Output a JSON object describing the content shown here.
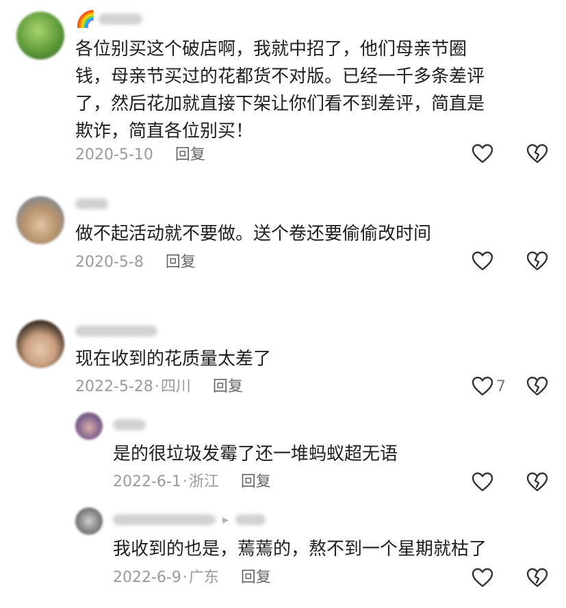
{
  "comments": [
    {
      "text_lines": [
        "各位别买这个破店啊，我就中招了，他们母亲节圈",
        "钱，母亲节买过的花都货不对版。已经一千多条差评",
        "了，然后花加就直接下架让你们看不到差评，简直是",
        "欺诈，简直各位别买！"
      ],
      "date": "2020-5-10",
      "location": "",
      "reply_label": "回复",
      "like_count": "",
      "user_badge": "🌈",
      "avatar_colors": [
        "#3f7f2f",
        "#9ccf5a"
      ]
    },
    {
      "text_lines": [
        "做不起活动就不要做。送个卷还要偷偷改时间"
      ],
      "date": "2020-5-8",
      "location": "",
      "reply_label": "回复",
      "like_count": "",
      "avatar_colors": [
        "#6a86a6",
        "#d9b89a"
      ]
    },
    {
      "text_lines": [
        "现在收到的花质量太差了"
      ],
      "date": "2022-5-28",
      "location": "四川",
      "reply_label": "回复",
      "like_count": "7",
      "avatar_colors": [
        "#3a2a20",
        "#e0c2a6"
      ],
      "replies": [
        {
          "text_lines": [
            "是的很垃圾发霉了还一堆蚂蚁超无语"
          ],
          "date": "2022-6-1",
          "location": "浙江",
          "reply_label": "回复",
          "like_count": "",
          "avatar_colors": [
            "#5a4a80",
            "#c9a3a0"
          ]
        },
        {
          "text_lines": [
            "我收到的也是，蔫蔫的，熬不到一个星期就枯了"
          ],
          "date": "2022-6-9",
          "location": "广东",
          "reply_label": "回复",
          "like_count": "",
          "avatar_colors": [
            "#555555",
            "#bbbbbb"
          ]
        }
      ]
    }
  ],
  "icons": {
    "like": "heart-outline-icon",
    "dislike": "broken-heart-icon"
  },
  "colors": {
    "text": "#1e1e1e",
    "meta": "#9a9a9a",
    "icon": "#333333"
  }
}
